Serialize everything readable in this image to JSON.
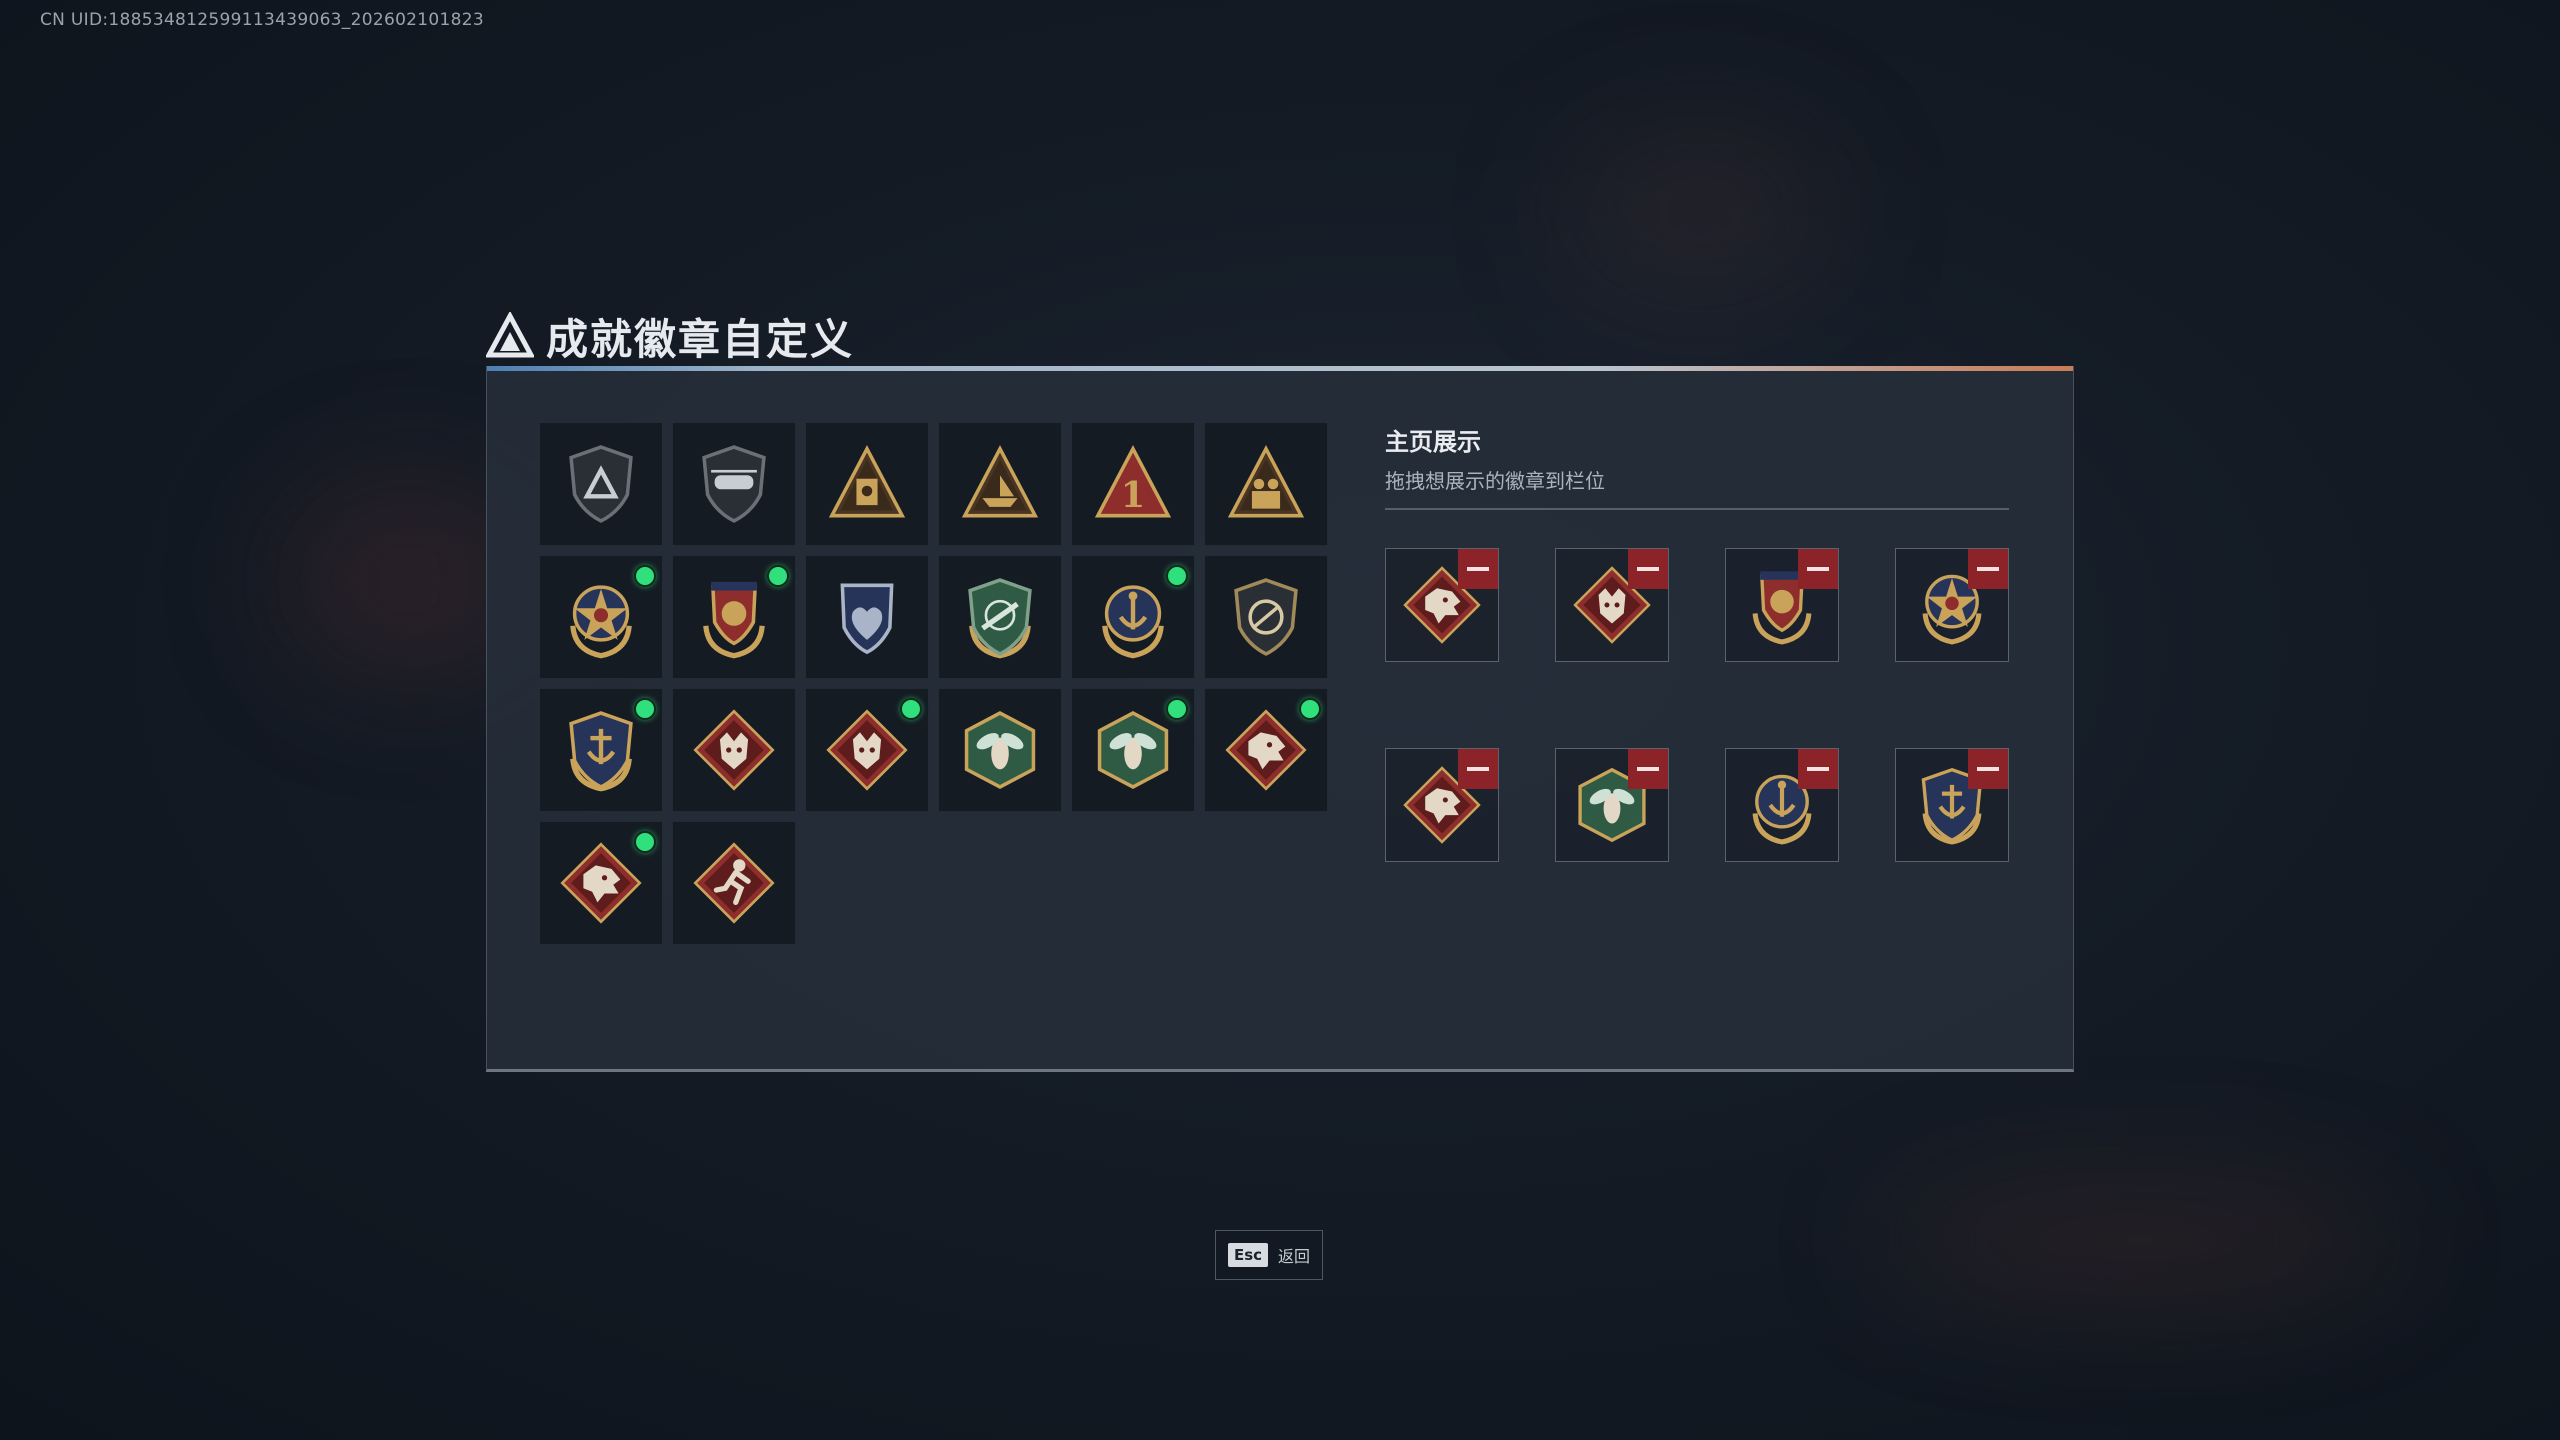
{
  "uid_text": "CN UID:188534812599113439063_202602101823",
  "header": {
    "title": "成就徽章自定义",
    "logo_icon": "delta-triangle-icon"
  },
  "colors": {
    "new_dot": "#2fe07c",
    "remove": "#8c2329",
    "bronze": "#b58c4a",
    "crimson": "#8e2e2c",
    "navy": "#27345a"
  },
  "badges": [
    {
      "icon": "dark-shield-triangle-badge",
      "new": false
    },
    {
      "icon": "dark-shield-helicopter-badge",
      "new": false
    },
    {
      "icon": "gold-triangle-vault-badge",
      "new": false
    },
    {
      "icon": "gold-triangle-ship-badge",
      "new": false
    },
    {
      "icon": "gold-triangle-number-one-badge",
      "new": false
    },
    {
      "icon": "gold-triangle-soldiers-badge",
      "new": false
    },
    {
      "icon": "gold-star-compass-badge",
      "new": true
    },
    {
      "icon": "navy-crest-crown-badge",
      "new": true
    },
    {
      "icon": "silver-crest-heart-badge",
      "new": false
    },
    {
      "icon": "green-shield-rifle-badge",
      "new": false
    },
    {
      "icon": "navy-shield-anchor-badge",
      "new": true
    },
    {
      "icon": "dark-shield-sniper-badge",
      "new": false
    },
    {
      "icon": "navy-shield-anchor-laurel-badge",
      "new": true
    },
    {
      "icon": "crimson-diamond-wolf-badge",
      "new": false
    },
    {
      "icon": "crimson-diamond-wolf-badge",
      "new": true
    },
    {
      "icon": "green-hex-wasp-badge",
      "new": false
    },
    {
      "icon": "green-hex-wasp-badge",
      "new": true
    },
    {
      "icon": "crimson-diamond-dragon-badge",
      "new": true
    },
    {
      "icon": "crimson-diamond-dragon-badge",
      "new": true
    },
    {
      "icon": "crimson-diamond-runner-badge",
      "new": false
    }
  ],
  "showcase": {
    "title": "主页展示",
    "subtitle": "拖拽想展示的徽章到栏位",
    "slots": [
      {
        "icon": "crimson-diamond-dragon-badge"
      },
      {
        "icon": "crimson-diamond-wolf-badge"
      },
      {
        "icon": "navy-crest-crown-badge"
      },
      {
        "icon": "gold-star-compass-badge"
      },
      {
        "icon": "crimson-diamond-dragon-badge"
      },
      {
        "icon": "green-hex-wasp-badge"
      },
      {
        "icon": "navy-shield-anchor-badge"
      },
      {
        "icon": "navy-shield-anchor-laurel-badge"
      }
    ]
  },
  "footer": {
    "esc_key": "Esc",
    "esc_label": "返回"
  }
}
